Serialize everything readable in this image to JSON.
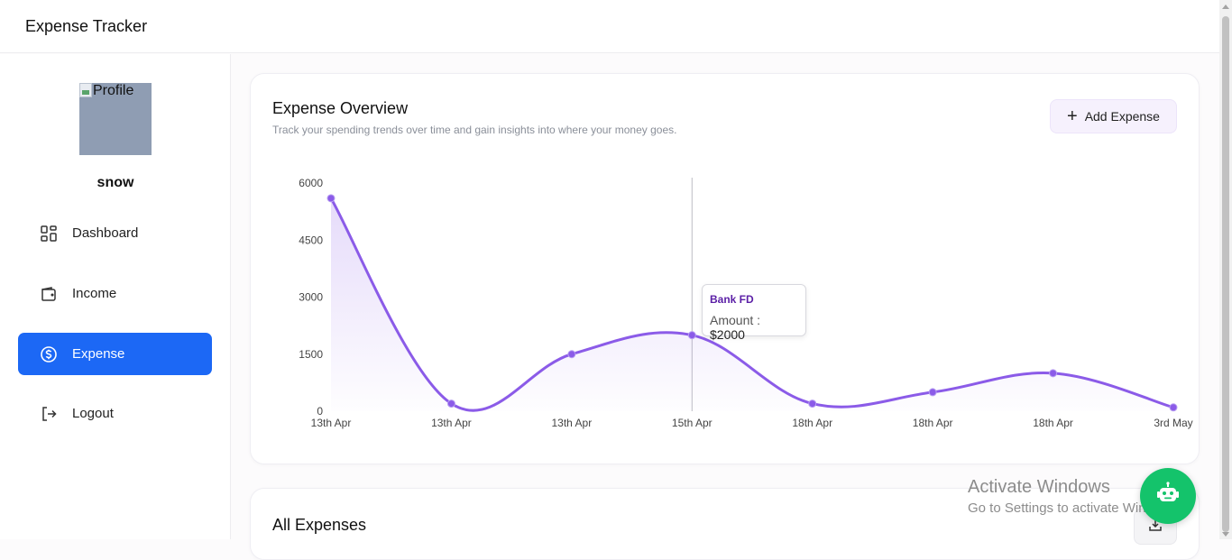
{
  "app": {
    "title": "Expense Tracker"
  },
  "profile": {
    "image_alt": "Profile",
    "username": "snow"
  },
  "sidebar": {
    "items": [
      {
        "label": "Dashboard",
        "icon": "dashboard-icon"
      },
      {
        "label": "Income",
        "icon": "wallet-icon"
      },
      {
        "label": "Expense",
        "icon": "dollar-circle-icon",
        "active": true
      },
      {
        "label": "Logout",
        "icon": "logout-icon"
      }
    ]
  },
  "overview": {
    "title": "Expense Overview",
    "subtitle": "Track your spending trends over time and gain insights into where your money goes.",
    "add_button": "Add Expense"
  },
  "tooltip": {
    "title": "Bank FD",
    "label": "Amount :",
    "value": "$2000"
  },
  "all_expenses": {
    "title": "All Expenses"
  },
  "watermark": {
    "line1": "Activate Windows",
    "line2": "Go to Settings to activate Windows."
  },
  "colors": {
    "accent": "#1c68f5",
    "line": "#8b5be8",
    "tooltip_title": "#5b1fa6",
    "chatbot": "#14c36b"
  },
  "chart_data": {
    "type": "area",
    "categories": [
      "13th Apr",
      "13th Apr",
      "13th Apr",
      "15th Apr",
      "18th Apr",
      "18th Apr",
      "18th Apr",
      "3rd May"
    ],
    "values": [
      5600,
      200,
      1500,
      2000,
      200,
      500,
      1000,
      100
    ],
    "yticks": [
      0,
      1500,
      3000,
      4500,
      6000
    ],
    "ylim": [
      0,
      6000
    ],
    "highlighted_index": 3,
    "grid": false,
    "legend": "none"
  }
}
